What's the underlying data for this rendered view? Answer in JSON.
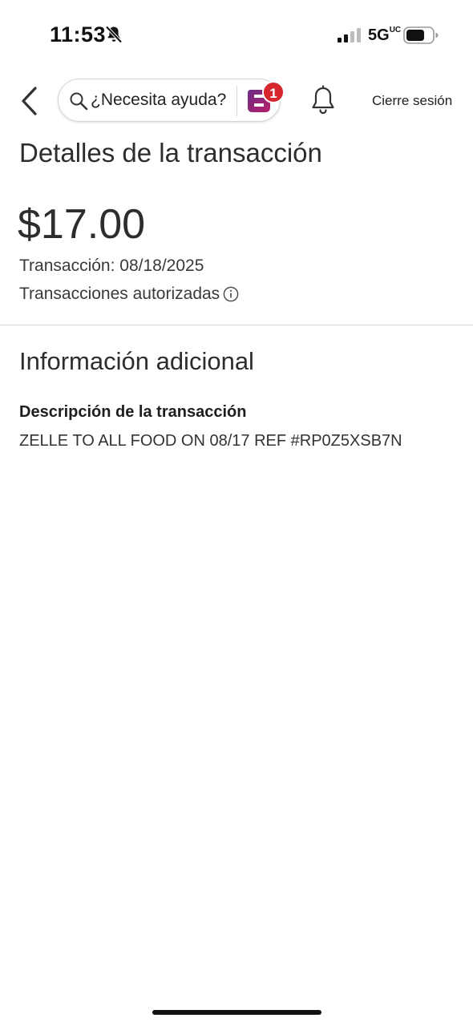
{
  "status_bar": {
    "time": "11:53",
    "network": "5G",
    "network_sup": "UC"
  },
  "header": {
    "search_text": "¿Necesita ayuda?",
    "badge_count": "1",
    "logout_label": "Cierre sesión"
  },
  "transaction": {
    "page_title": "Detalles de la transacción",
    "amount": "$17.00",
    "date_line": "Transacción: 08/18/2025",
    "status": "Transacciones autorizadas"
  },
  "additional_info": {
    "section_title": "Información adicional",
    "description_label": "Descripción de la transacción",
    "description_value": "ZELLE TO ALL FOOD ON 08/17 REF #RP0Z5XSB7N"
  },
  "colors": {
    "badge_red": "#d7262d",
    "logo_purple": "#6b2d84",
    "logo_magenta": "#b81f6c"
  },
  "icons": {
    "muted": "bell-slash-icon",
    "signal": "signal-icon",
    "battery": "battery-icon",
    "back": "chevron-left-icon",
    "search": "search-icon",
    "assistant": "assistant-logo-icon",
    "notifications": "notification-bell-icon",
    "info": "info-icon"
  }
}
